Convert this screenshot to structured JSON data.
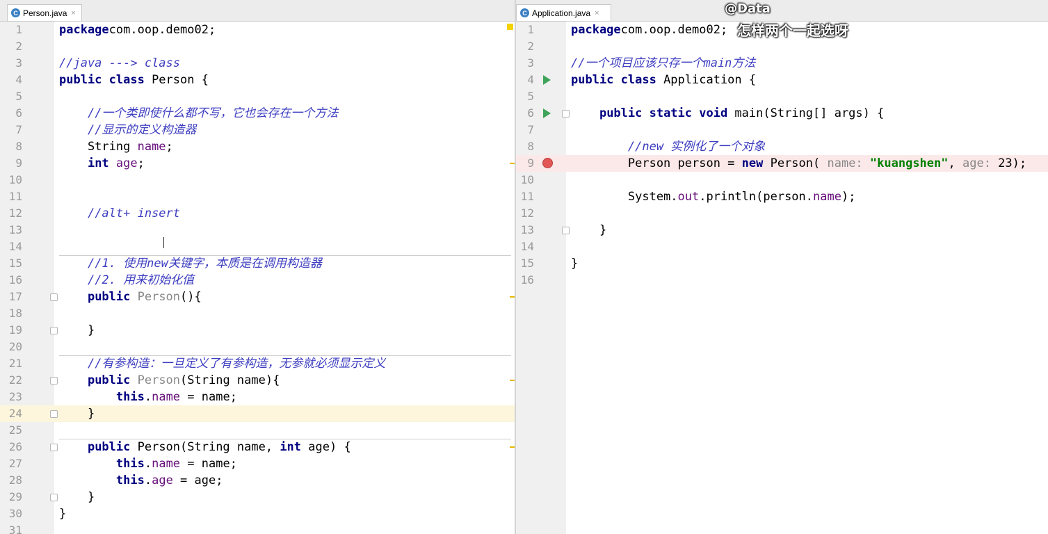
{
  "left_editor": {
    "tab": {
      "icon": "class-file-icon",
      "icon_glyph": "C",
      "label": "Person.java",
      "close": "×"
    },
    "lines": [
      {
        "n": "1",
        "parts": [
          [
            "kw",
            "package"
          ],
          [
            "",
            "com.oop.demo02;"
          ]
        ]
      },
      {
        "n": "2",
        "parts": []
      },
      {
        "n": "3",
        "parts": [
          [
            "cm",
            "//java ---> class"
          ]
        ]
      },
      {
        "n": "4",
        "parts": [
          [
            "kw",
            "public class"
          ],
          [
            "",
            " Person {"
          ]
        ]
      },
      {
        "n": "5",
        "parts": []
      },
      {
        "n": "6",
        "parts": [
          [
            "",
            "    "
          ],
          [
            "cm",
            "//一个类即使什么都不写，它也会存在一个方法"
          ]
        ]
      },
      {
        "n": "7",
        "parts": [
          [
            "",
            "    "
          ],
          [
            "cm",
            "//显示的定义构造器"
          ]
        ]
      },
      {
        "n": "8",
        "parts": [
          [
            "",
            "    String "
          ],
          [
            "fld",
            "name"
          ],
          [
            "",
            ";"
          ]
        ]
      },
      {
        "n": "9",
        "parts": [
          [
            "",
            "    "
          ],
          [
            "kw",
            "int"
          ],
          [
            "",
            " "
          ],
          [
            "fld",
            "age"
          ],
          [
            "",
            ";"
          ]
        ]
      },
      {
        "n": "10",
        "parts": []
      },
      {
        "n": "11",
        "parts": []
      },
      {
        "n": "12",
        "parts": [
          [
            "",
            "    "
          ],
          [
            "cm",
            "//alt+ insert"
          ]
        ]
      },
      {
        "n": "13",
        "parts": []
      },
      {
        "n": "14",
        "parts": []
      },
      {
        "n": "15",
        "parts": [
          [
            "",
            "    "
          ],
          [
            "cm",
            "//1. 使用new关键字，本质是在调用构造器"
          ]
        ]
      },
      {
        "n": "16",
        "parts": [
          [
            "",
            "    "
          ],
          [
            "cm",
            "//2. 用来初始化值"
          ]
        ]
      },
      {
        "n": "17",
        "parts": [
          [
            "",
            "    "
          ],
          [
            "kw",
            "public"
          ],
          [
            "hint",
            " Person"
          ],
          [
            "",
            "(){"
          ]
        ]
      },
      {
        "n": "18",
        "parts": []
      },
      {
        "n": "19",
        "parts": [
          [
            "",
            "    }"
          ]
        ]
      },
      {
        "n": "20",
        "parts": []
      },
      {
        "n": "21",
        "parts": [
          [
            "",
            "    "
          ],
          [
            "cm",
            "//有参构造：一旦定义了有参构造，无参就必须显示定义"
          ]
        ]
      },
      {
        "n": "22",
        "parts": [
          [
            "",
            "    "
          ],
          [
            "kw",
            "public"
          ],
          [
            "hint",
            " Person"
          ],
          [
            "",
            "(String name){"
          ]
        ]
      },
      {
        "n": "23",
        "parts": [
          [
            "",
            "        "
          ],
          [
            "kw",
            "this"
          ],
          [
            "",
            "."
          ],
          [
            "fld",
            "name"
          ],
          [
            "",
            " = name;"
          ]
        ]
      },
      {
        "n": "24",
        "parts": [
          [
            "",
            "    }"
          ]
        ]
      },
      {
        "n": "25",
        "parts": []
      },
      {
        "n": "26",
        "parts": [
          [
            "",
            "    "
          ],
          [
            "kw",
            "public"
          ],
          [
            "",
            " Person(String name, "
          ],
          [
            "kw",
            "int"
          ],
          [
            "",
            " age) {"
          ]
        ]
      },
      {
        "n": "27",
        "parts": [
          [
            "",
            "        "
          ],
          [
            "kw",
            "this"
          ],
          [
            "",
            "."
          ],
          [
            "fld",
            "name"
          ],
          [
            "",
            " = name;"
          ]
        ]
      },
      {
        "n": "28",
        "parts": [
          [
            "",
            "        "
          ],
          [
            "kw",
            "this"
          ],
          [
            "",
            "."
          ],
          [
            "fld",
            "age"
          ],
          [
            "",
            " = age;"
          ]
        ]
      },
      {
        "n": "29",
        "parts": [
          [
            "",
            "    }"
          ]
        ]
      },
      {
        "n": "30",
        "parts": [
          [
            "",
            "}"
          ]
        ]
      },
      {
        "n": "31",
        "parts": []
      }
    ]
  },
  "right_editor": {
    "tab": {
      "icon": "class-file-icon",
      "icon_glyph": "C",
      "label": "Application.java",
      "close": "×"
    },
    "lines": [
      {
        "n": "1",
        "parts": [
          [
            "kw",
            "package"
          ],
          [
            "",
            "com.oop.demo02;"
          ]
        ]
      },
      {
        "n": "2",
        "parts": []
      },
      {
        "n": "3",
        "parts": [
          [
            "cm",
            "//一个项目应该只存一个main方法"
          ]
        ]
      },
      {
        "n": "4",
        "parts": [
          [
            "kw",
            "public class"
          ],
          [
            "",
            " Application {"
          ]
        ]
      },
      {
        "n": "5",
        "parts": []
      },
      {
        "n": "6",
        "parts": [
          [
            "",
            "    "
          ],
          [
            "kw",
            "public static void"
          ],
          [
            "",
            " main(String[] args) {"
          ]
        ]
      },
      {
        "n": "7",
        "parts": []
      },
      {
        "n": "8",
        "parts": [
          [
            "",
            "        "
          ],
          [
            "cm",
            "//new 实例化了一个对象"
          ]
        ]
      },
      {
        "n": "9",
        "parts": [
          [
            "",
            "        Person person = "
          ],
          [
            "kw",
            "new"
          ],
          [
            "",
            " Person( "
          ],
          [
            "hint",
            "name: "
          ],
          [
            "str",
            "\"kuangshen\""
          ],
          [
            "",
            ", "
          ],
          [
            "hint",
            "age: "
          ],
          [
            "",
            "23);"
          ]
        ]
      },
      {
        "n": "10",
        "parts": []
      },
      {
        "n": "11",
        "parts": [
          [
            "",
            "        System."
          ],
          [
            "fld",
            "out"
          ],
          [
            "",
            ".println(person."
          ],
          [
            "fld",
            "name"
          ],
          [
            "",
            ");"
          ]
        ]
      },
      {
        "n": "12",
        "parts": []
      },
      {
        "n": "13",
        "parts": [
          [
            "",
            "    }"
          ]
        ]
      },
      {
        "n": "14",
        "parts": []
      },
      {
        "n": "15",
        "parts": [
          [
            "",
            "}"
          ]
        ]
      },
      {
        "n": "16",
        "parts": []
      }
    ]
  },
  "watermark": {
    "line1": "@Data",
    "line2": "怎样两个一起选呀"
  },
  "colors": {
    "keyword": "#000080",
    "comment": "#3d3dc0",
    "field": "#660e7a",
    "string": "#008000",
    "breakpoint": "#e25656",
    "run": "#3fa35a"
  }
}
